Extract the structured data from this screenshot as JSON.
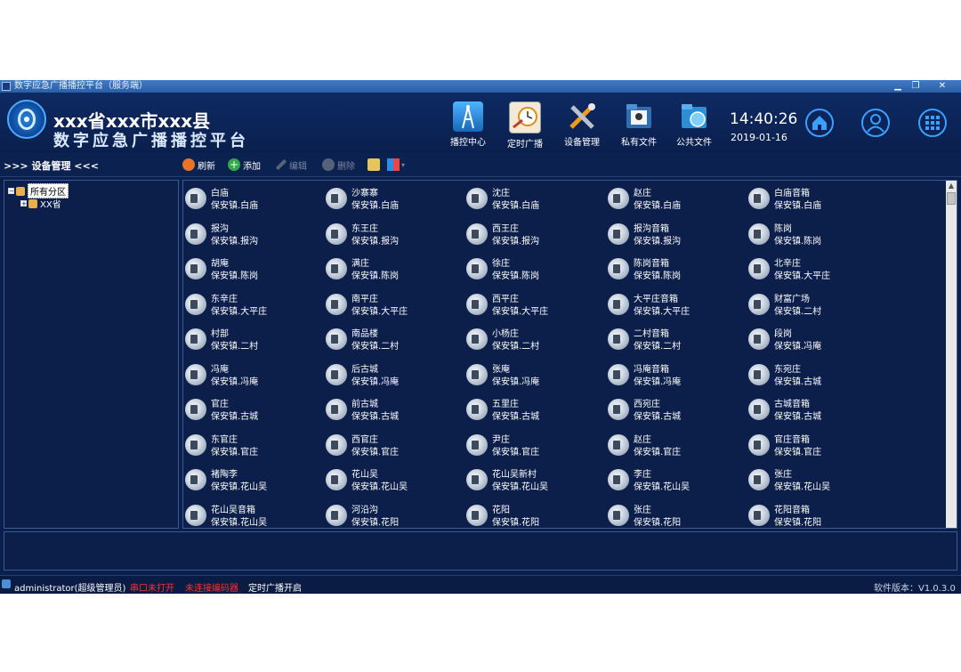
{
  "window": {
    "title": "数字应急广播播控平台（服务端）",
    "controls": {
      "minimize": "▁",
      "restore": "❐",
      "close": "✕"
    }
  },
  "header": {
    "title_line1": "xxx省xxx市xxx县",
    "title_line2": "数字应急广播播控平台",
    "nav": [
      {
        "label": "播控中心",
        "icon": "broadcast-tower-icon",
        "color": "#1f8fe0"
      },
      {
        "label": "定时广播",
        "icon": "timer-icon",
        "color": "#d7c9a6"
      },
      {
        "label": "设备管理",
        "icon": "tools-icon",
        "color": "#f29a1b"
      },
      {
        "label": "私有文件",
        "icon": "private-folder-icon",
        "color": "#2c6fb5"
      },
      {
        "label": "公共文件",
        "icon": "public-folder-icon",
        "color": "#2c8fd6"
      }
    ],
    "time": "14:40:26",
    "date": "2019-01-16",
    "buttons": [
      "home-icon",
      "user-icon",
      "apps-grid-icon"
    ]
  },
  "toolbar": {
    "section_title": ">>> 设备管理 <<<",
    "refresh": "刷新",
    "add": "添加",
    "edit": "编辑",
    "delete": "删除"
  },
  "tree": {
    "root": "所有分区",
    "child": "XX省"
  },
  "devices": [
    [
      "白庙",
      "保安镇.白庙"
    ],
    [
      "沙寨寨",
      "保安镇.白庙"
    ],
    [
      "沈庄",
      "保安镇.白庙"
    ],
    [
      "赵庄",
      "保安镇.白庙"
    ],
    [
      "白庙音箱",
      "保安镇.白庙"
    ],
    [
      "报沟",
      "保安镇.报沟"
    ],
    [
      "东王庄",
      "保安镇.报沟"
    ],
    [
      "西王庄",
      "保安镇.报沟"
    ],
    [
      "报沟音箱",
      "保安镇.报沟"
    ],
    [
      "陈岗",
      "保安镇.陈岗"
    ],
    [
      "胡庵",
      "保安镇.陈岗"
    ],
    [
      "满庄",
      "保安镇.陈岗"
    ],
    [
      "徐庄",
      "保安镇.陈岗"
    ],
    [
      "陈岗音箱",
      "保安镇.陈岗"
    ],
    [
      "北辛庄",
      "保安镇.大平庄"
    ],
    [
      "东辛庄",
      "保安镇.大平庄"
    ],
    [
      "南平庄",
      "保安镇.大平庄"
    ],
    [
      "西平庄",
      "保安镇.大平庄"
    ],
    [
      "大平庄音箱",
      "保安镇.大平庄"
    ],
    [
      "财富广场",
      "保安镇.二村"
    ],
    [
      "村部",
      "保安镇.二村"
    ],
    [
      "南品楼",
      "保安镇.二村"
    ],
    [
      "小杨庄",
      "保安镇.二村"
    ],
    [
      "二村音箱",
      "保安镇.二村"
    ],
    [
      "段岗",
      "保安镇.冯庵"
    ],
    [
      "冯庵",
      "保安镇.冯庵"
    ],
    [
      "后古城",
      "保安镇.冯庵"
    ],
    [
      "张庵",
      "保安镇.冯庵"
    ],
    [
      "冯庵音箱",
      "保安镇.冯庵"
    ],
    [
      "东宛庄",
      "保安镇.古城"
    ],
    [
      "官庄",
      "保安镇.古城"
    ],
    [
      "前古城",
      "保安镇.古城"
    ],
    [
      "五里庄",
      "保安镇.古城"
    ],
    [
      "西宛庄",
      "保安镇.古城"
    ],
    [
      "古城音箱",
      "保安镇.古城"
    ],
    [
      "东官庄",
      "保安镇.官庄"
    ],
    [
      "西官庄",
      "保安镇.官庄"
    ],
    [
      "尹庄",
      "保安镇.官庄"
    ],
    [
      "赵庄",
      "保安镇.官庄"
    ],
    [
      "官庄音箱",
      "保安镇.官庄"
    ],
    [
      "褚陶李",
      "保安镇.花山吴"
    ],
    [
      "花山吴",
      "保安镇.花山吴"
    ],
    [
      "花山吴新村",
      "保安镇.花山吴"
    ],
    [
      "李庄",
      "保安镇.花山吴"
    ],
    [
      "张庄",
      "保安镇.花山吴"
    ],
    [
      "花山吴音箱",
      "保安镇.花山吴"
    ],
    [
      "河沿沟",
      "保安镇.花阳"
    ],
    [
      "花阳",
      "保安镇.花阳"
    ],
    [
      "张庄",
      "保安镇.花阳"
    ],
    [
      "花阳音箱",
      "保安镇.花阳"
    ]
  ],
  "status": {
    "user": "administrator(超级管理员)",
    "serial": "串口未打开",
    "encoder": "未连接编码器",
    "timer": "定时广播开启",
    "version": "软件版本：V1.0.3.0",
    "alert_color": "#ff3030"
  }
}
